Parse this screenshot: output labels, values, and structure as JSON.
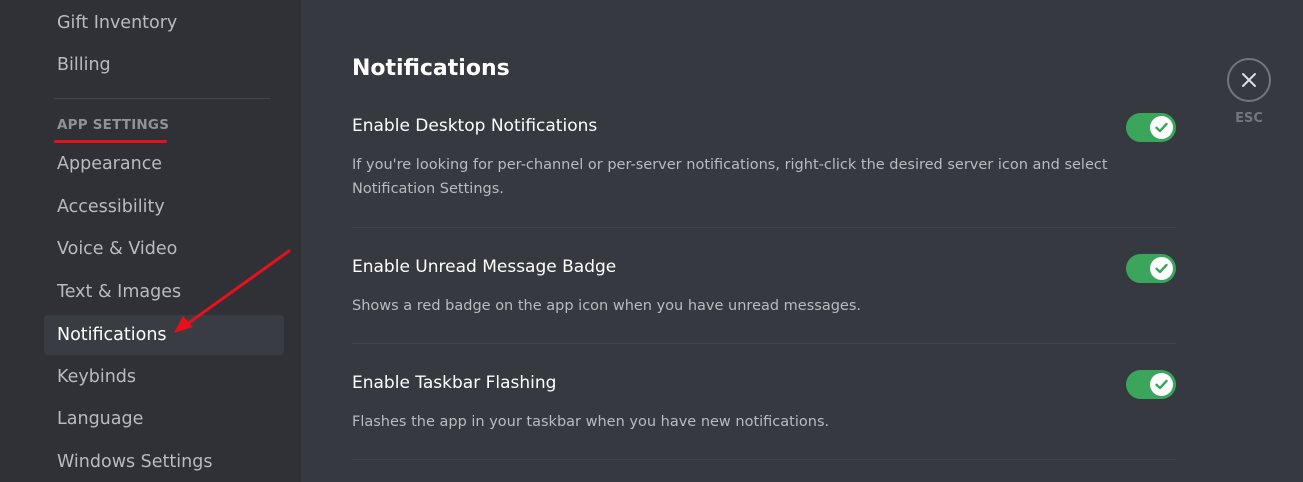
{
  "sidebar": {
    "items_top": [
      {
        "label": "Gift Inventory"
      },
      {
        "label": "Billing"
      }
    ],
    "section_header": "APP SETTINGS",
    "items": [
      {
        "label": "Appearance"
      },
      {
        "label": "Accessibility"
      },
      {
        "label": "Voice & Video"
      },
      {
        "label": "Text & Images"
      },
      {
        "label": "Notifications",
        "selected": true
      },
      {
        "label": "Keybinds"
      },
      {
        "label": "Language"
      },
      {
        "label": "Windows Settings"
      }
    ]
  },
  "main": {
    "title": "Notifications",
    "settings": [
      {
        "label": "Enable Desktop Notifications",
        "description": "If you're looking for per-channel or per-server notifications, right-click the desired server icon and select Notification Settings.",
        "enabled": true
      },
      {
        "label": "Enable Unread Message Badge",
        "description": "Shows a red badge on the app icon when you have unread messages.",
        "enabled": true
      },
      {
        "label": "Enable Taskbar Flashing",
        "description": "Flashes the app in your taskbar when you have new notifications.",
        "enabled": true
      }
    ]
  },
  "close": {
    "esc_label": "ESC",
    "icon": "close-icon"
  },
  "colors": {
    "sidebar_bg": "#2f3136",
    "content_bg": "#36393f",
    "toggle_on": "#3ba55c",
    "annotation_red": "#e8101a"
  }
}
